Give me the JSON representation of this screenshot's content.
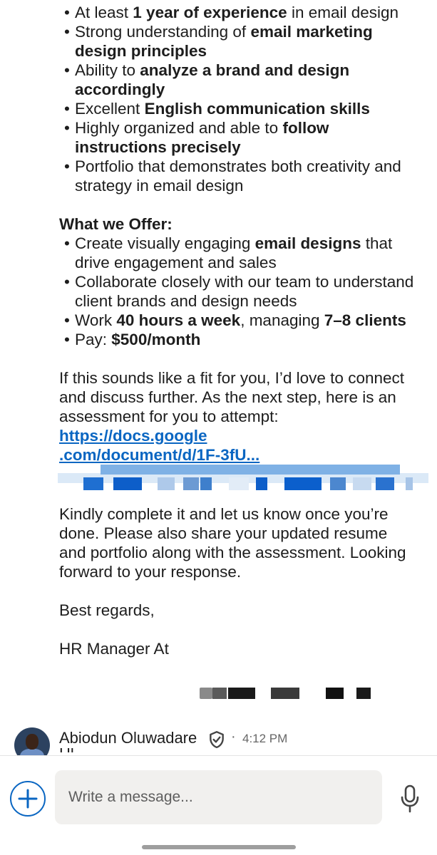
{
  "requirements": [
    [
      {
        "t": "At least "
      },
      {
        "t": "1 year of experience",
        "b": true
      },
      {
        "t": " in email design"
      }
    ],
    [
      {
        "t": "Strong understanding of "
      },
      {
        "t": "email marketing design principles",
        "b": true
      }
    ],
    [
      {
        "t": "Ability to "
      },
      {
        "t": "analyze a brand and design accordingly",
        "b": true
      }
    ],
    [
      {
        "t": "Excellent "
      },
      {
        "t": "English communication skills",
        "b": true
      }
    ],
    [
      {
        "t": "Highly organized and able to "
      },
      {
        "t": "follow instructions precisely",
        "b": true
      }
    ],
    [
      {
        "t": "Portfolio that demonstrates both creativity and strategy in email design"
      }
    ]
  ],
  "offer_heading": "What we Offer:",
  "offers": [
    [
      {
        "t": "Create visually engaging "
      },
      {
        "t": "email designs",
        "b": true
      },
      {
        "t": " that drive engagement and sales"
      }
    ],
    [
      {
        "t": "Collaborate closely with our team to understand client brands and design needs"
      }
    ],
    [
      {
        "t": "Work "
      },
      {
        "t": "40 hours a week",
        "b": true
      },
      {
        "t": ", managing "
      },
      {
        "t": "7–8 clients",
        "b": true
      }
    ],
    [
      {
        "t": "Pay: "
      },
      {
        "t": "$500/month",
        "b": true
      }
    ]
  ],
  "closing_paragraph_1": "If this sounds like a fit for you, I’d love to connect and discuss further. As the next step, here is an assessment for you to attempt:",
  "assessment_link_line1": "https://docs.google",
  "assessment_link_line2": ".com/document/d/1F-3fU...",
  "closing_paragraph_2": "Kindly complete it and let us know once you’re done. Please also share your updated resume and portfolio along with the assessment. Looking forward to your response.",
  "sign_off": "Best regards,",
  "signature_prefix": "HR Manager At",
  "sender": {
    "name": "Abiodun Oluwadare",
    "separator": "·",
    "time": "4:12 PM",
    "next_message_peek": "Hi"
  },
  "compose": {
    "placeholder": "Write a message..."
  },
  "colors": {
    "link": "#0a66c2",
    "add_button": "#0a66c2",
    "input_bg": "#f1f0ee"
  }
}
